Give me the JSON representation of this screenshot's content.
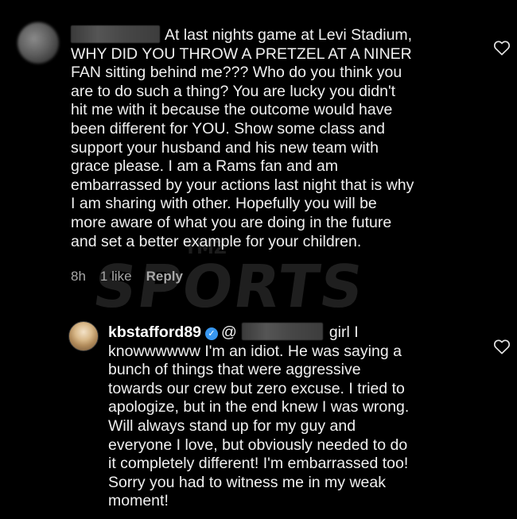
{
  "watermark": {
    "brand": "SPORTS",
    "brand_prefix": "TMZ"
  },
  "comment_1": {
    "avatar": "blurred-avatar",
    "username_redacted": true,
    "text": "At last nights game at Levi Stadium,\nWHY DID YOU THROW A PRETZEL AT A NINER\nFAN sitting behind me??? Who do you think you\nare to do such a thing?  You are lucky you didn't\nhit me with it because the outcome would have\nbeen different for YOU.  Show some class and\nsupport your husband and his new team with\ngrace please.  I am a Rams fan and am\nembarrassed by your actions last night that is why\nI am sharing with other.  Hopefully you will be\nmore aware of what you are doing in the future\nand set a better example for your children.",
    "time": "8h",
    "likes": "1 like",
    "reply_label": "Reply",
    "like_icon": "heart-outline-icon"
  },
  "comment_2": {
    "avatar": "kbstafford89-avatar",
    "username": "kbstafford89",
    "verified_icon": "verified-badge-icon",
    "mention_prefix": "@",
    "first_line_tail": "girl I",
    "text": "knowwwwww I'm an idiot. He was saying a\nbunch of things that were aggressive\ntowards our crew but zero excuse. I tried to\napologize, but in the end knew I was wrong.\nWill always stand up for my guy and\neveryone I love, but obviously needed to do\nit completely different! I'm embarrassed too!\nSorry you had to witness me in my weak\nmoment!",
    "like_icon": "heart-outline-icon"
  },
  "colors": {
    "background": "#000000",
    "text": "#f0f0f0",
    "meta": "#a8a8a8",
    "verified": "#3897f0"
  }
}
